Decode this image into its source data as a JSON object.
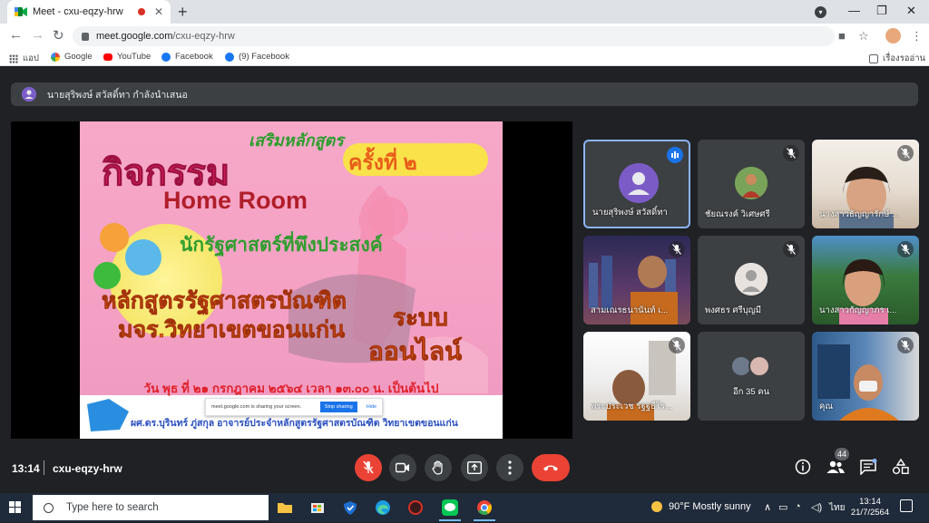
{
  "browser": {
    "tab_title": "Meet - cxu-eqzy-hrw",
    "tab_close": "✕",
    "new_tab": "+",
    "url_host": "meet.google.com",
    "url_path": "/cxu-eqzy-hrw",
    "window_controls": {
      "minimize": "—",
      "restore": "❐",
      "close": "✕"
    },
    "bookmarks": [
      {
        "label": "แอป",
        "color": "#5f6368"
      },
      {
        "label": "Google",
        "color": "#4285f4"
      },
      {
        "label": "YouTube",
        "color": "#ff0000"
      },
      {
        "label": "Facebook",
        "color": "#1877f2"
      },
      {
        "label": "(9) Facebook",
        "color": "#1877f2"
      }
    ],
    "reading_list": "เรื่องรออ่าน"
  },
  "meet": {
    "presenting_banner": "นายสุริพงษ์ สวัสดิ์ทา กำลังนำเสนอ",
    "slide": {
      "title_top": "เสริมหลักสูตร",
      "title_round": "ครั้งที่ ๒",
      "title_main": "กิจกรรม",
      "title_sub": "Home Room",
      "subtitle": "นักรัฐศาสตร์ที่พึงประสงค์",
      "program_line1": "หลักสูตรรัฐศาสตรบัณฑิต",
      "program_line2": "มจร.วิทยาเขตขอนแก่น",
      "online_line1": "ระบบ",
      "online_line2": "ออนไลน์",
      "date_line": "วัน พุธ ที่ ๒๑ กรกฎาคม ๒๕๖๔ เวลา ๑๓.๐๐ น. เป็นต้นไป",
      "presenter_line": "ผศ.ดร.บุรินทร์ ภู่สกุล อาจารย์ประจำหลักสูตรรัฐศาสตรบัณฑิต วิทยาเขตขอนแก่น",
      "sharing_notice": "meet.google.com is sharing your screen.",
      "stop_sharing": "Stop sharing",
      "hide": "Hide"
    },
    "tiles": [
      {
        "name": "นายสุริพงษ์ สวัสดิ์ทา"
      },
      {
        "name": "ชัยณรงค์ วิเศษศรี"
      },
      {
        "name": "นางสาวธัญญารักษ์ ..."
      },
      {
        "name": "สามเณรธนานันท์ เ..."
      },
      {
        "name": "พงศธร ศรีบุญมี"
      },
      {
        "name": "นางสาวกัญญาภร เ..."
      },
      {
        "name": "พระประเวช รฐฐธีโร..."
      },
      {
        "name": "อีก 35 คน"
      },
      {
        "name": "คุณ"
      }
    ],
    "bottom": {
      "time": "13:14",
      "code": "cxu-eqzy-hrw",
      "participants_count": "44"
    }
  },
  "taskbar": {
    "search_placeholder": "Type here to search",
    "weather": "90°F  Mostly sunny",
    "lang": "ไทย",
    "time": "13:14",
    "date": "21/7/2564"
  },
  "colors": {
    "hangup": "#ea4335",
    "speaking": "#8ab4f8",
    "meet_bg": "#202124"
  }
}
